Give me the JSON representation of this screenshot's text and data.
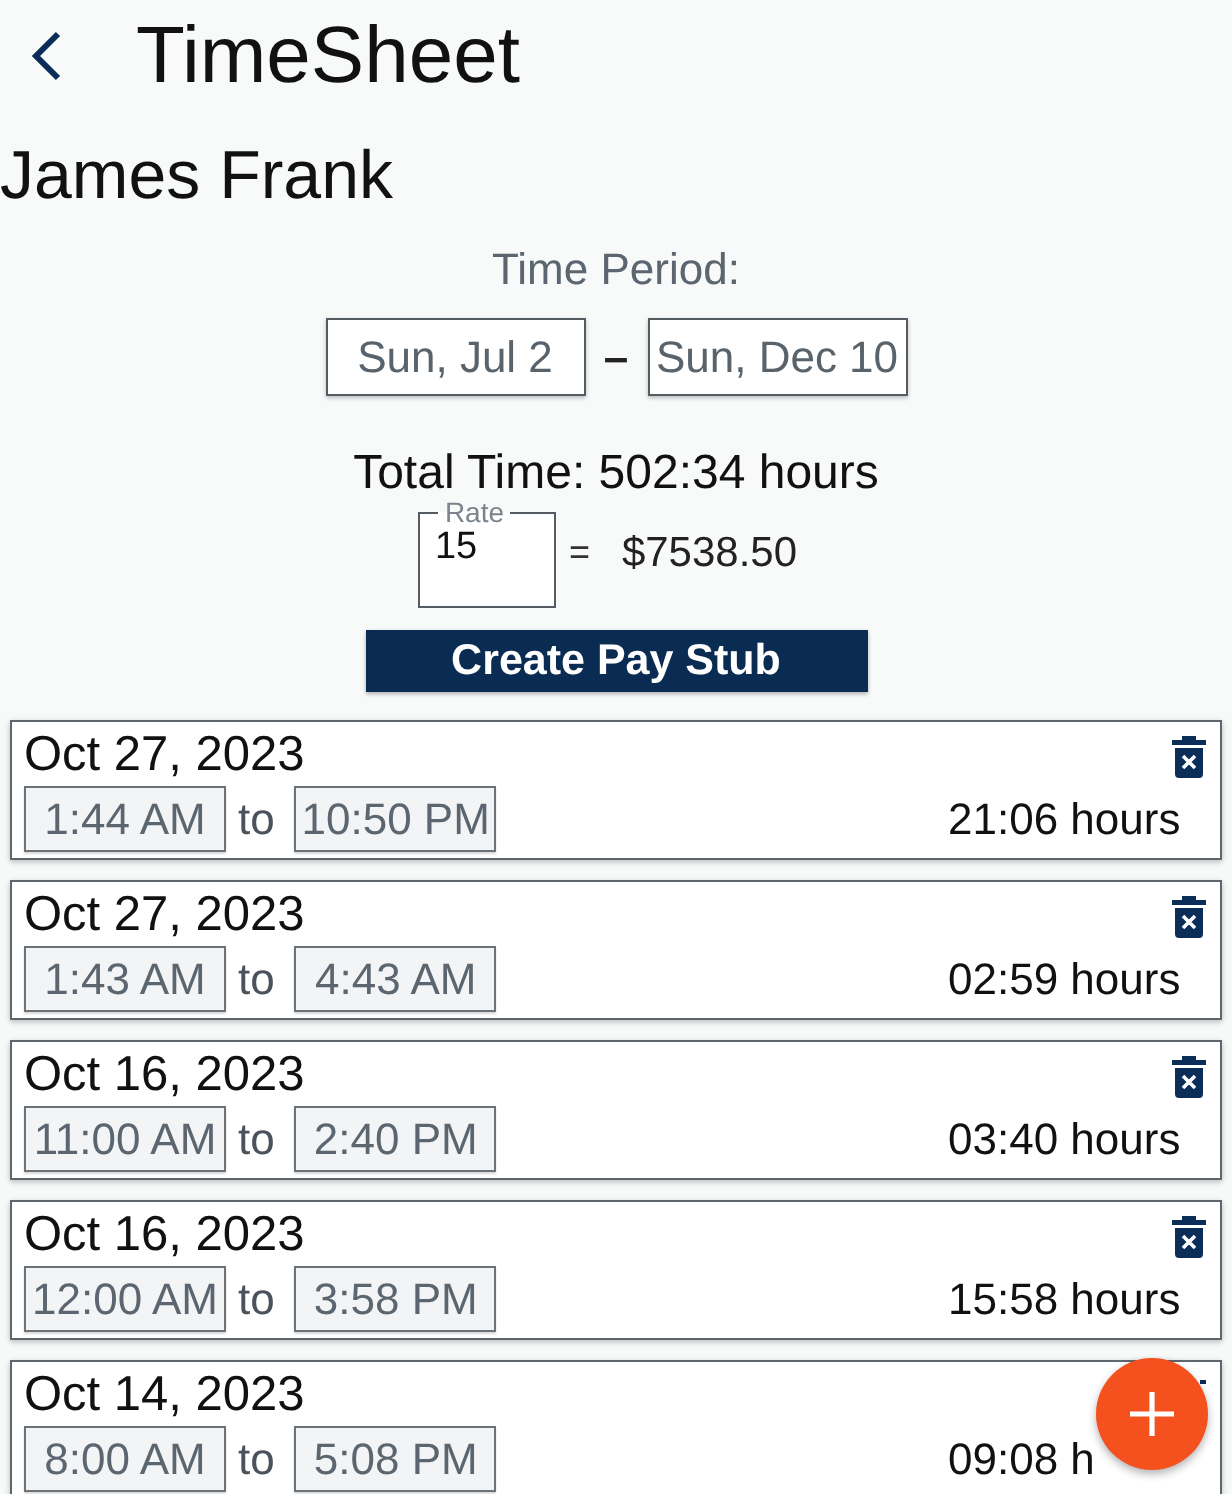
{
  "header": {
    "title": "TimeSheet"
  },
  "employee": {
    "name": "James Frank"
  },
  "period": {
    "label": "Time Period:",
    "start": "Sun, Jul 2",
    "separator": "–",
    "end": "Sun, Dec 10"
  },
  "total": {
    "text": "Total Time: 502:34 hours"
  },
  "rate": {
    "label": "Rate",
    "value": "15",
    "equals": "=",
    "amount": "$7538.50"
  },
  "create_button": {
    "label": "Create Pay Stub"
  },
  "entries": [
    {
      "date": "Oct 27, 2023",
      "start": "1:44 AM",
      "connector": "to",
      "end": "10:50 PM",
      "duration": "21:06 hours"
    },
    {
      "date": "Oct 27, 2023",
      "start": "1:43 AM",
      "connector": "to",
      "end": "4:43 AM",
      "duration": "02:59 hours"
    },
    {
      "date": "Oct 16, 2023",
      "start": "11:00 AM",
      "connector": "to",
      "end": "2:40 PM",
      "duration": "03:40 hours"
    },
    {
      "date": "Oct 16, 2023",
      "start": "12:00 AM",
      "connector": "to",
      "end": "3:58 PM",
      "duration": "15:58 hours"
    },
    {
      "date": "Oct 14, 2023",
      "start": "8:00 AM",
      "connector": "to",
      "end": "5:08 PM",
      "duration": "09:08 h"
    }
  ]
}
